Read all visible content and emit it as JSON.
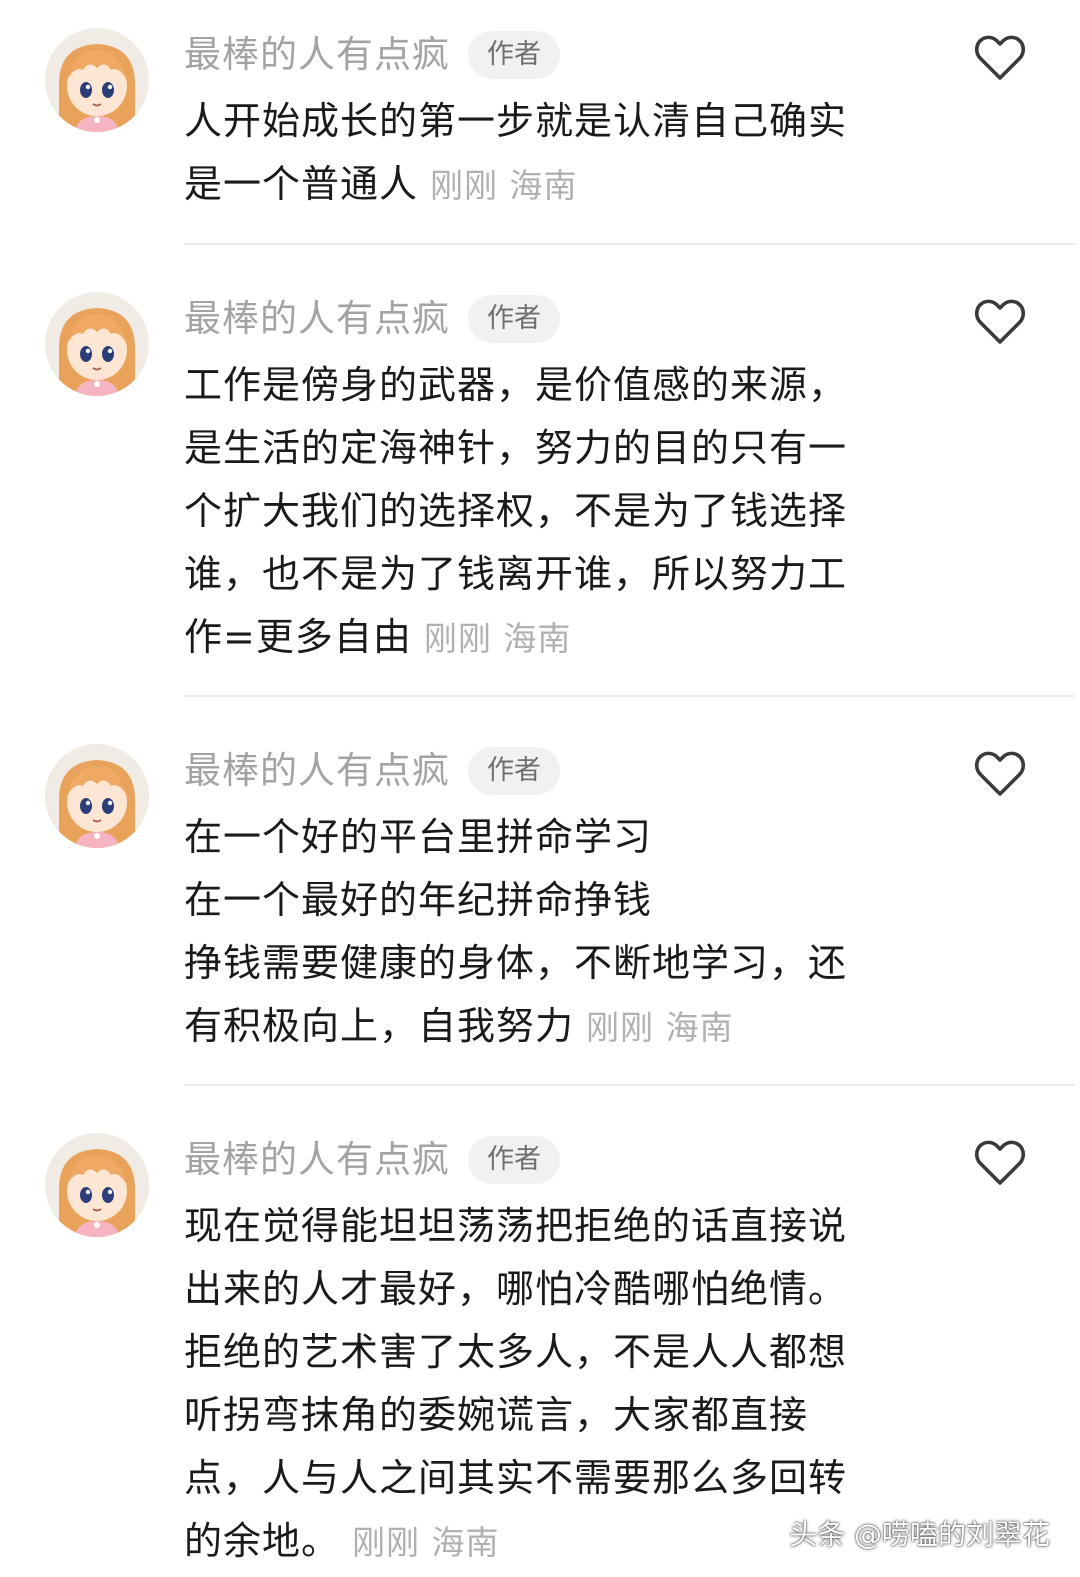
{
  "colors": {
    "username": "#a3a3a3",
    "badge_bg": "#f1f1f1",
    "badge_text": "#6f6f6f",
    "body_text": "#1a1a1a",
    "meta_text": "#b0b0b0",
    "divider": "#ececec",
    "like_icon": "#3a3a3a"
  },
  "comments": [
    {
      "username": "最棒的人有点疯",
      "badge": "作者",
      "avatar_icon": "anime-girl-avatar",
      "like_icon": "heart-outline-icon",
      "lines": [
        "人开始成长的第一步就是认清自己确实",
        "是一个普通人"
      ],
      "time": "刚刚",
      "location": "海南"
    },
    {
      "username": "最棒的人有点疯",
      "badge": "作者",
      "avatar_icon": "anime-girl-avatar",
      "like_icon": "heart-outline-icon",
      "lines": [
        "工作是傍身的武器，是价值感的来源，",
        "是生活的定海神针，努力的目的只有一",
        "个扩大我们的选择权，不是为了钱选择",
        "谁，也不是为了钱离开谁，所以努力工",
        "作=更多自由"
      ],
      "time": "刚刚",
      "location": "海南"
    },
    {
      "username": "最棒的人有点疯",
      "badge": "作者",
      "avatar_icon": "anime-girl-avatar",
      "like_icon": "heart-outline-icon",
      "lines": [
        "在一个好的平台里拼命学习",
        "在一个最好的年纪拼命挣钱",
        "挣钱需要健康的身体，不断地学习，还",
        "有积极向上，自我努力"
      ],
      "time": "刚刚",
      "location": "海南"
    },
    {
      "username": "最棒的人有点疯",
      "badge": "作者",
      "avatar_icon": "anime-girl-avatar",
      "like_icon": "heart-outline-icon",
      "lines": [
        "现在觉得能坦坦荡荡把拒绝的话直接说",
        "出来的人才最好，哪怕冷酷哪怕绝情。",
        "拒绝的艺术害了太多人，不是人人都想",
        "听拐弯抹角的委婉谎言，大家都直接",
        "点，人与人之间其实不需要那么多回转",
        "的余地。"
      ],
      "time": "刚刚",
      "location": "海南"
    }
  ],
  "watermark": "头条 @唠嗑的刘翠花"
}
